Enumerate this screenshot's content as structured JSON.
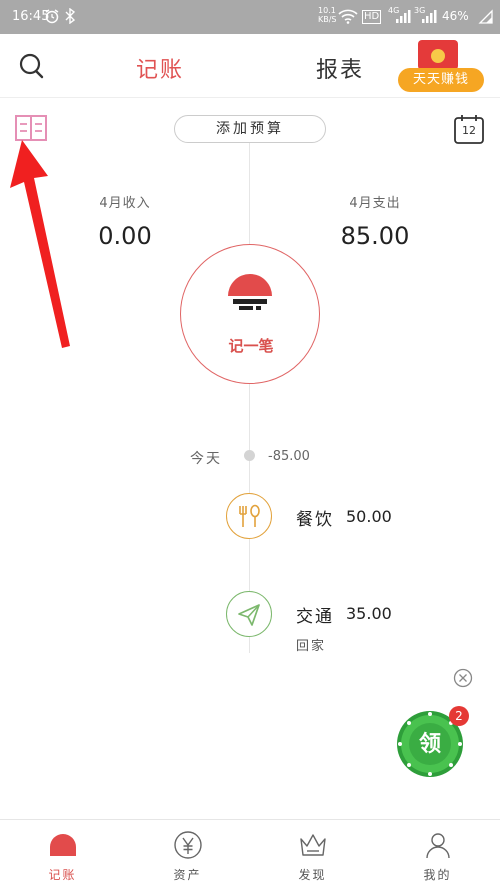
{
  "status_bar": {
    "time": "16:45",
    "net_speed": "10.1\nKB/S",
    "hd": "HD",
    "net1": "4G",
    "net2": "3G",
    "battery": "46%"
  },
  "header": {
    "tab_ledger": "记账",
    "tab_report": "报表",
    "earn_badge": "天天赚钱"
  },
  "budget": {
    "label": "添加预算"
  },
  "calendar": {
    "day": "12"
  },
  "summary": {
    "income_label": "4月收入",
    "income_value": "0.00",
    "expense_label": "4月支出",
    "expense_value": "85.00"
  },
  "record_button": {
    "label": "记一笔"
  },
  "today": {
    "label": "今天",
    "amount": "-85.00"
  },
  "entries": [
    {
      "icon": "dining-icon",
      "title": "餐饮",
      "amount": "50.00",
      "note": "",
      "color": "#e2a23c"
    },
    {
      "icon": "paper-plane-icon",
      "title": "交通",
      "amount": "35.00",
      "note": "回家",
      "color": "#7cb86d"
    }
  ],
  "reward": {
    "label": "领",
    "badge": "2"
  },
  "bottom_nav": [
    {
      "label": "记账",
      "icon": "ledger-icon",
      "active": true
    },
    {
      "label": "资产",
      "icon": "yen-icon",
      "active": false
    },
    {
      "label": "发现",
      "icon": "crown-icon",
      "active": false
    },
    {
      "label": "我的",
      "icon": "profile-icon",
      "active": false
    }
  ],
  "colors": {
    "accent": "#e05353",
    "status_bar": "#a9a9a9",
    "earn_orange": "#f6a623",
    "reward_green": "#3cb043"
  }
}
